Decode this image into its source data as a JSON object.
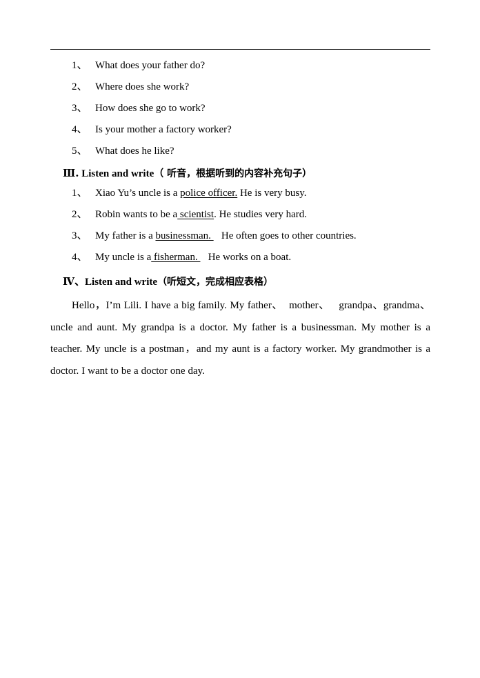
{
  "document": {
    "page_background": "#ffffff",
    "text_color": "#000000",
    "header_rule": "horizontal-rule"
  },
  "section_ii": {
    "questions": [
      {
        "number": "1、",
        "text": "What does your father do?"
      },
      {
        "number": "2、",
        "text": "Where does she work?"
      },
      {
        "number": "3、",
        "text": "How does she go to work?"
      },
      {
        "number": "4、",
        "text": "Is your mother a factory worker?"
      },
      {
        "number": "5、",
        "text": "What does he like?"
      }
    ]
  },
  "section_iii": {
    "heading": {
      "roman": "Ⅲ.",
      "english": " Listen and write",
      "chinese": "（ 听音，根据听到的内容补充句子）"
    },
    "items": [
      {
        "number": "1、",
        "before": "Xiao Yu’s uncle is a ",
        "blank": "police officer.",
        "after": " He is very busy."
      },
      {
        "number": "2、",
        "before": "Robin wants to be a",
        "blank": " scientist",
        "after": ". He studies very hard."
      },
      {
        "number": "3、",
        "before": "My father is a ",
        "blank": "businessman. ",
        "after": "   He often goes to other countries."
      },
      {
        "number": "4、",
        "before": "My uncle is a",
        "blank": " fisherman. ",
        "after": "   He works on a boat."
      }
    ]
  },
  "section_iv": {
    "heading": {
      "roman": "Ⅳ",
      "english": "、Listen and write",
      "chinese": "（听短文，完成相应表格）"
    },
    "passage": "Hello，I’m Lili. I have a big family. My father、  mother、   grandpa、grandma、uncle and aunt. My grandpa is a doctor. My father is a businessman. My mother is a teacher. My uncle is a postman，and my aunt is a factory worker. My grandmother is a doctor. I want to be a doctor one day."
  }
}
